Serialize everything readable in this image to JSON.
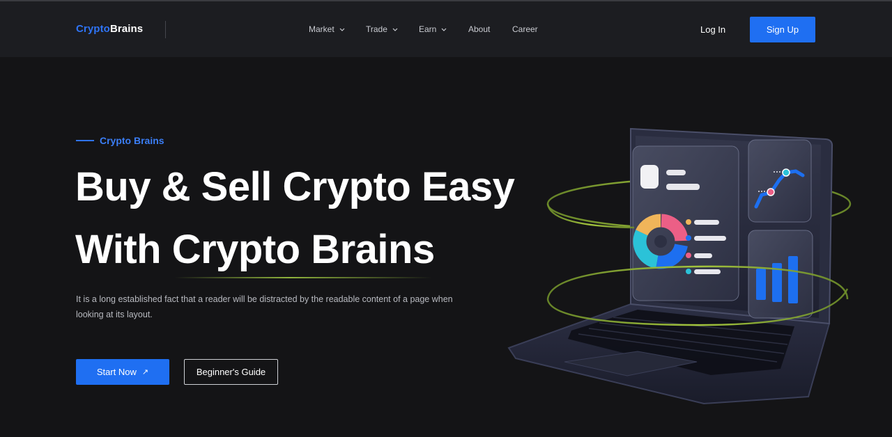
{
  "brand": {
    "part1": "Crypto",
    "part2": "Brains"
  },
  "nav": {
    "items": [
      {
        "label": "Market",
        "dropdown": true
      },
      {
        "label": "Trade",
        "dropdown": true
      },
      {
        "label": "Earn",
        "dropdown": true
      },
      {
        "label": "About",
        "dropdown": false
      },
      {
        "label": "Career",
        "dropdown": false
      }
    ],
    "login_label": "Log In",
    "signup_label": "Sign Up"
  },
  "hero": {
    "eyebrow": "Crypto Brains",
    "headline_line1": "Buy & Sell Crypto Easy",
    "headline_line2": "With Crypto Brains",
    "description": "It is a long established fact that a reader will be distracted by the readable content of a page when looking at its layout.",
    "primary_button": "Start Now",
    "primary_button_icon": "arrow-up-right-icon",
    "secondary_button": "Beginner's Guide"
  },
  "colors": {
    "background": "#141416",
    "navbar": "#1c1d21",
    "accent": "#1f6ff2",
    "highlight": "#8fb33c"
  }
}
